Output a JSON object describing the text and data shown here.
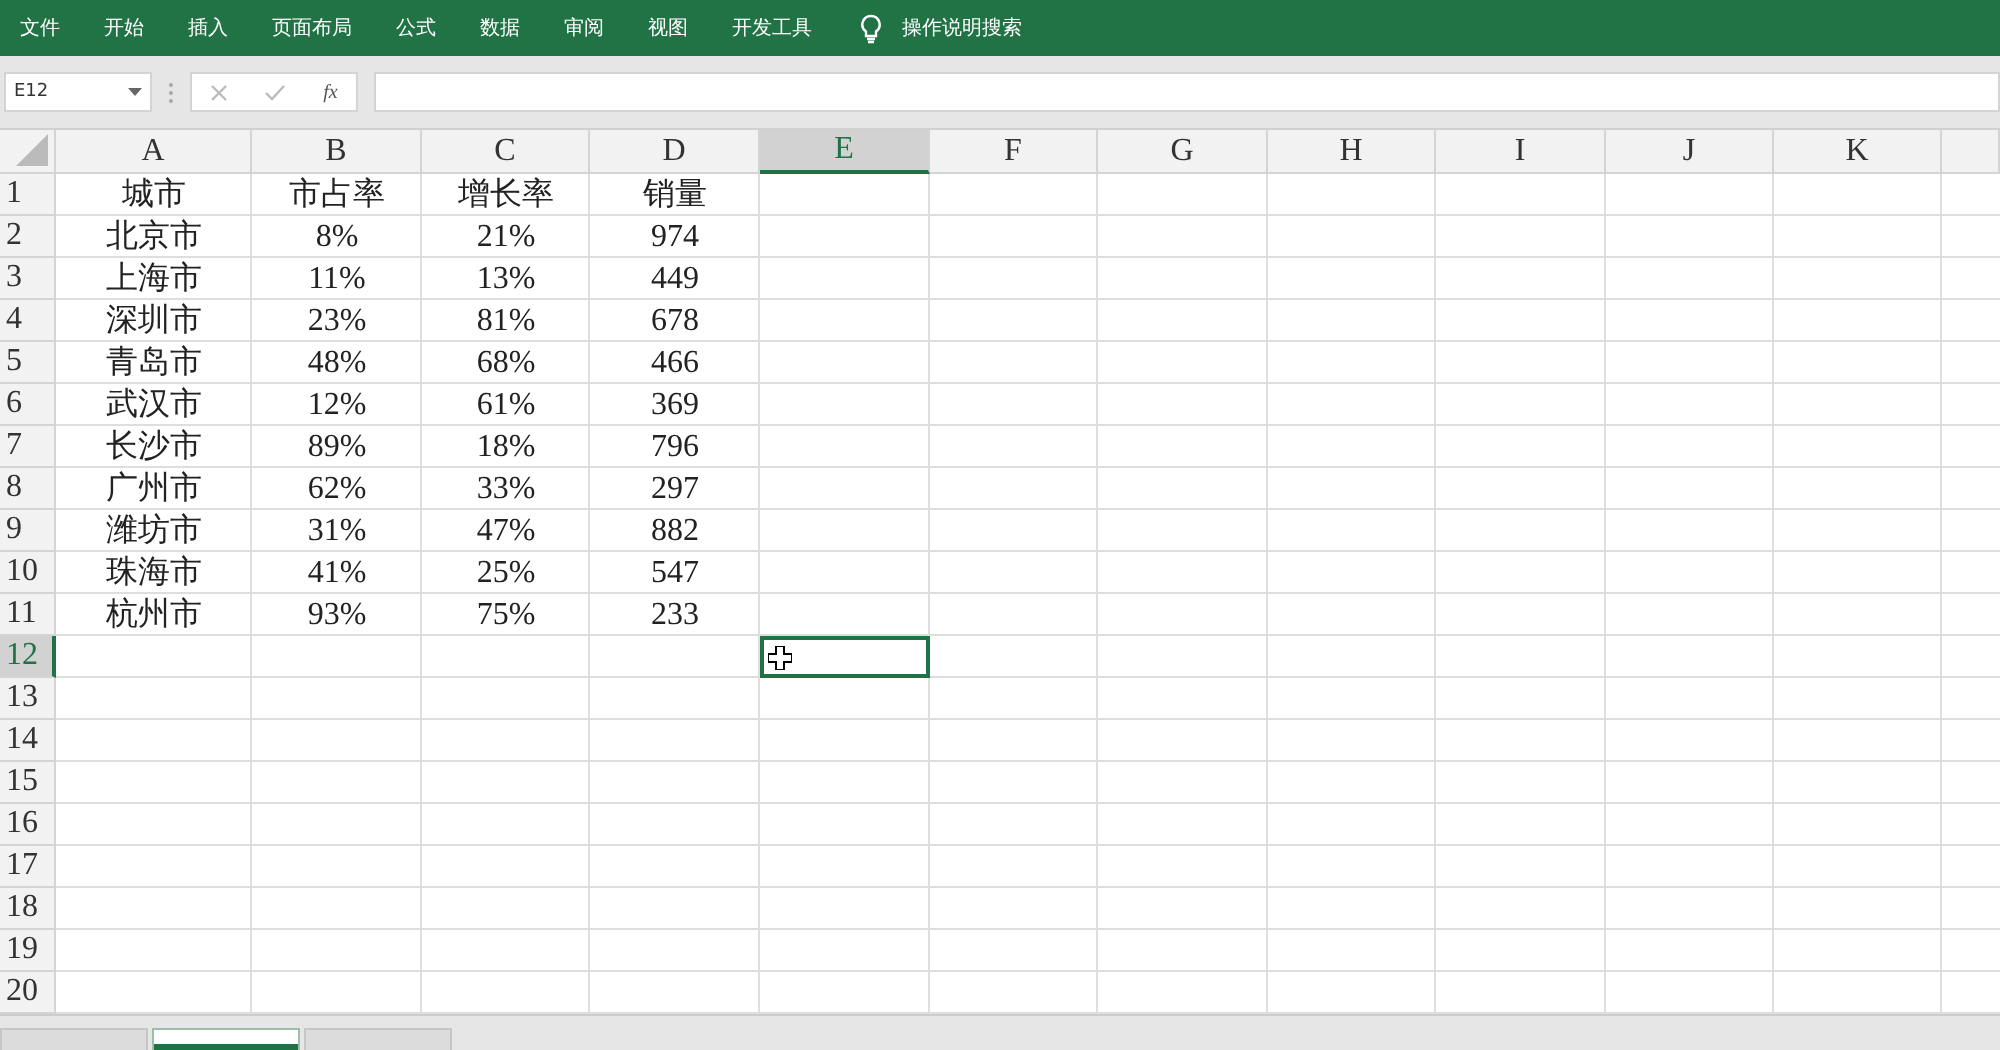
{
  "menu": [
    "文件",
    "开始",
    "插入",
    "页面布局",
    "公式",
    "数据",
    "审阅",
    "视图",
    "开发工具"
  ],
  "tell_me": "操作说明搜索",
  "name_box": "E12",
  "formula_icon": "fx",
  "columns": [
    {
      "label": "A",
      "selected": false
    },
    {
      "label": "B",
      "selected": false
    },
    {
      "label": "C",
      "selected": false
    },
    {
      "label": "D",
      "selected": false
    },
    {
      "label": "E",
      "selected": true
    },
    {
      "label": "F",
      "selected": false
    },
    {
      "label": "G",
      "selected": false
    },
    {
      "label": "H",
      "selected": false
    },
    {
      "label": "I",
      "selected": false
    },
    {
      "label": "J",
      "selected": false
    },
    {
      "label": "K",
      "selected": false
    }
  ],
  "rows": [
    {
      "number": "1",
      "selected": false,
      "cells": [
        "城市",
        "市占率",
        "增长率",
        "销量"
      ]
    },
    {
      "number": "2",
      "selected": false,
      "cells": [
        "北京市",
        "8%",
        "21%",
        "974"
      ]
    },
    {
      "number": "3",
      "selected": false,
      "cells": [
        "上海市",
        "11%",
        "13%",
        "449"
      ]
    },
    {
      "number": "4",
      "selected": false,
      "cells": [
        "深圳市",
        "23%",
        "81%",
        "678"
      ]
    },
    {
      "number": "5",
      "selected": false,
      "cells": [
        "青岛市",
        "48%",
        "68%",
        "466"
      ]
    },
    {
      "number": "6",
      "selected": false,
      "cells": [
        "武汉市",
        "12%",
        "61%",
        "369"
      ]
    },
    {
      "number": "7",
      "selected": false,
      "cells": [
        "长沙市",
        "89%",
        "18%",
        "796"
      ]
    },
    {
      "number": "8",
      "selected": false,
      "cells": [
        "广州市",
        "62%",
        "33%",
        "297"
      ]
    },
    {
      "number": "9",
      "selected": false,
      "cells": [
        "潍坊市",
        "31%",
        "47%",
        "882"
      ]
    },
    {
      "number": "10",
      "selected": false,
      "cells": [
        "珠海市",
        "41%",
        "25%",
        "547"
      ]
    },
    {
      "number": "11",
      "selected": false,
      "cells": [
        "杭州市",
        "93%",
        "75%",
        "233"
      ]
    },
    {
      "number": "12",
      "selected": true,
      "cells": []
    },
    {
      "number": "13",
      "selected": false,
      "cells": []
    },
    {
      "number": "14",
      "selected": false,
      "cells": []
    },
    {
      "number": "15",
      "selected": false,
      "cells": []
    },
    {
      "number": "16",
      "selected": false,
      "cells": []
    },
    {
      "number": "17",
      "selected": false,
      "cells": []
    },
    {
      "number": "18",
      "selected": false,
      "cells": []
    },
    {
      "number": "19",
      "selected": false,
      "cells": []
    },
    {
      "number": "20",
      "selected": false,
      "cells": []
    }
  ],
  "sheet_tabs": [
    {
      "selected": false
    },
    {
      "selected": true
    },
    {
      "selected": false
    }
  ]
}
